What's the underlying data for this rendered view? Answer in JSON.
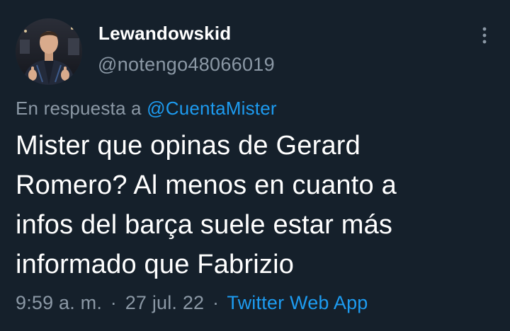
{
  "tweet": {
    "author": {
      "display_name": "Lewandowskid",
      "handle": "@notengo48066019",
      "avatar": "profile-photo"
    },
    "more_icon": "more-options-icon",
    "reply_context": {
      "prefix": "En respuesta a",
      "mention": "@CuentaMister"
    },
    "text_lines": [
      "Mister que opinas de Gerard",
      "Romero? Al menos en cuanto a",
      "infos del barça suele estar más",
      "informado que Fabrizio"
    ],
    "meta": {
      "time": "9:59 a. m.",
      "separator": "·",
      "date": "27 jul. 22",
      "source": "Twitter Web App"
    }
  },
  "colors": {
    "background": "#15202b",
    "primary_text": "#ffffff",
    "secondary_text": "#8b98a5",
    "accent": "#1d9bf0"
  }
}
